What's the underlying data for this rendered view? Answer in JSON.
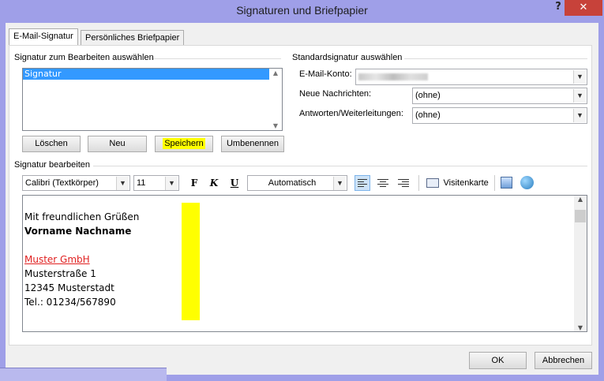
{
  "window": {
    "title": "Signaturen und Briefpapier",
    "help": "?",
    "close": "✕"
  },
  "tabs": [
    {
      "label": "E-Mail-Signatur",
      "active": true
    },
    {
      "label": "Persönliches Briefpapier",
      "active": false
    }
  ],
  "select_signature": {
    "label": "Signatur zum Bearbeiten auswählen",
    "items": [
      "Signatur"
    ],
    "selected": "Signatur",
    "buttons": {
      "delete": "Löschen",
      "new": "Neu",
      "save": "Speichern",
      "rename": "Umbenennen"
    },
    "highlight_color": "#ffff00"
  },
  "default_signature": {
    "label": "Standardsignatur auswählen",
    "account_label": "E-Mail-Konto:",
    "new_messages_label": "Neue Nachrichten:",
    "new_messages_value": "(ohne)",
    "replies_label": "Antworten/Weiterleitungen:",
    "replies_value": "(ohne)"
  },
  "editor": {
    "label": "Signatur bearbeiten",
    "font": "Calibri (Textkörper)",
    "size": "11",
    "bold": "F",
    "italic": "K",
    "underline": "U",
    "color": "Automatisch",
    "business_card": "Visitenkarte",
    "lines": [
      "Mit freundlichen Grüßen",
      "Vorname Nachname",
      "",
      "Muster GmbH",
      "Musterstraße 1",
      "12345 Musterstadt",
      "Tel.: 01234/567890"
    ],
    "link_color": "#e02020"
  },
  "footer": {
    "ok": "OK",
    "cancel": "Abbrechen"
  }
}
